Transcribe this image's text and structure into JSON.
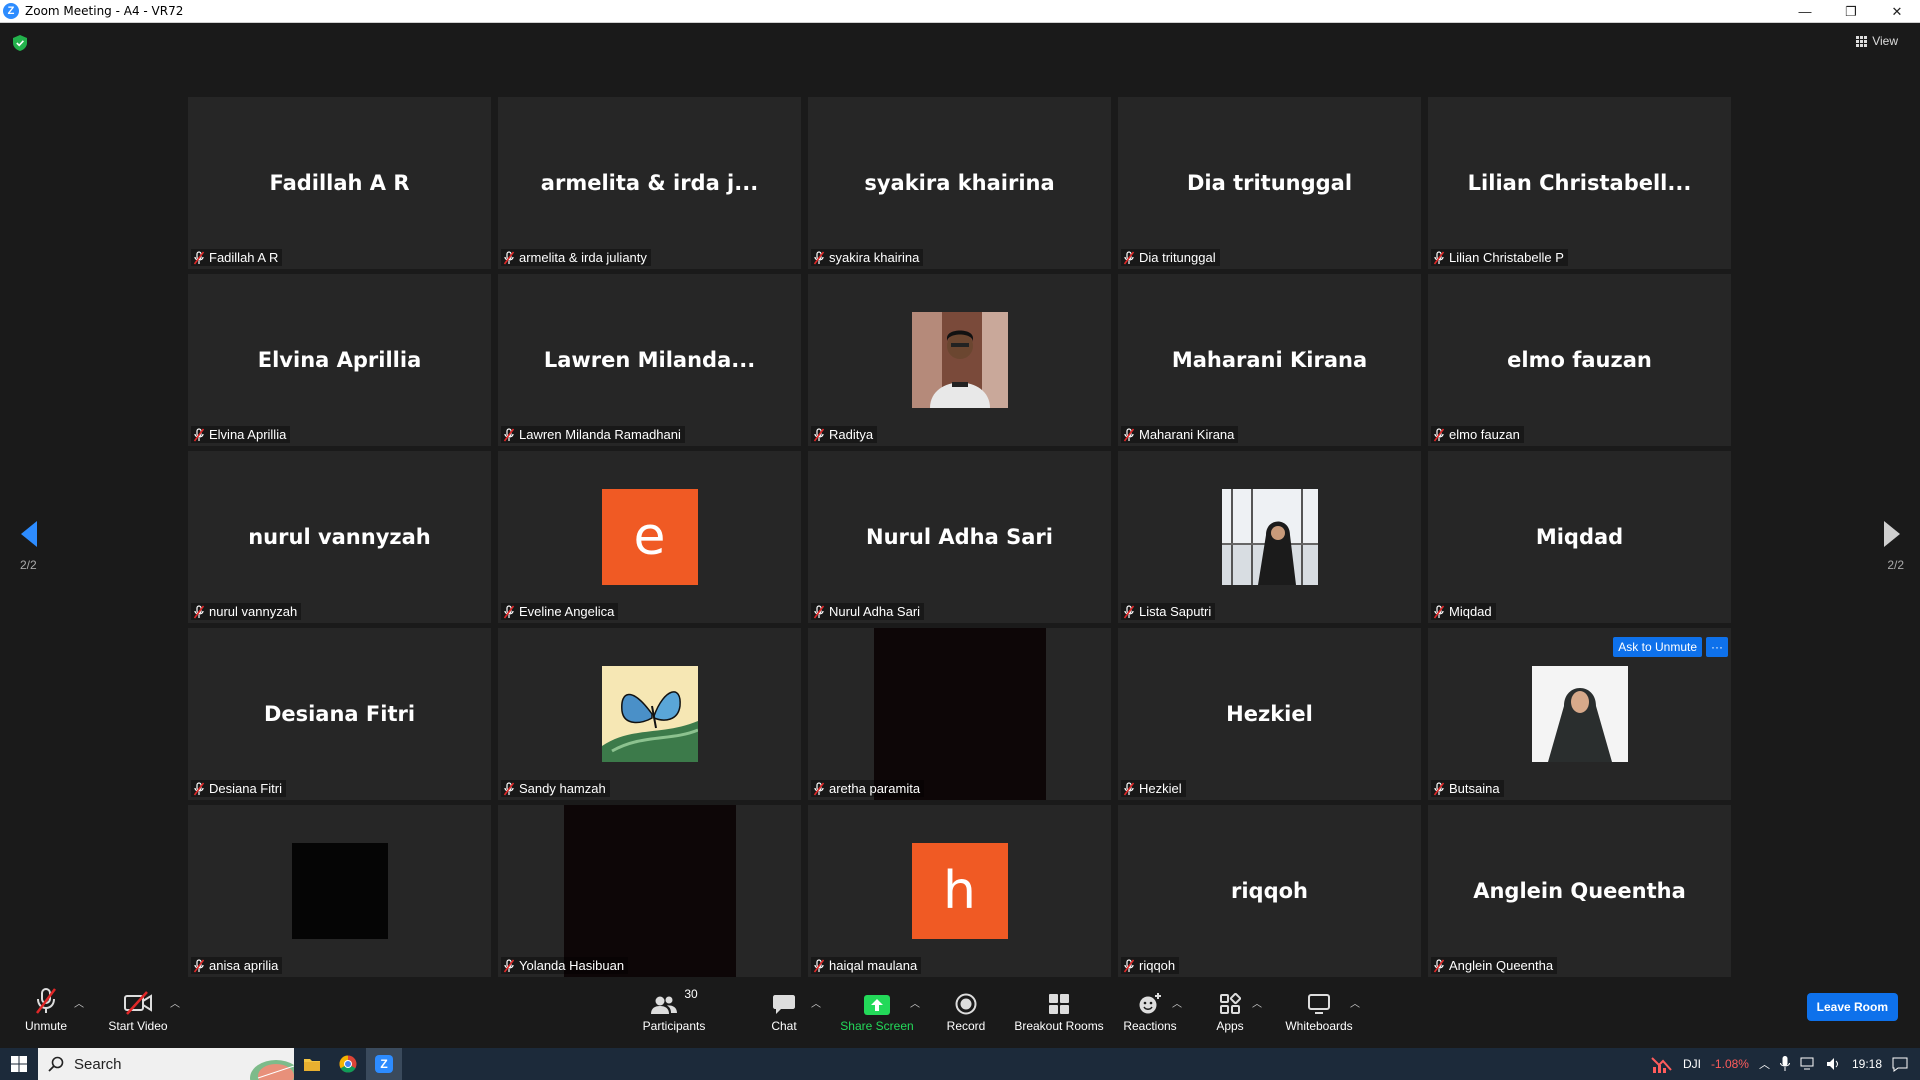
{
  "window": {
    "title": "Zoom Meeting - A4 - VR72",
    "minimize": "—",
    "restore": "❐",
    "close": "✕"
  },
  "header": {
    "view_label": "View"
  },
  "pagination": {
    "left": "2/2",
    "right": "2/2"
  },
  "tiles": [
    {
      "display": "Fadillah A R",
      "label": "Fadillah A R",
      "kind": "name"
    },
    {
      "display": "armelita & irda j...",
      "label": "armelita & irda julianty",
      "kind": "name"
    },
    {
      "display": "syakira khairina",
      "label": "syakira khairina",
      "kind": "name"
    },
    {
      "display": "Dia tritunggal",
      "label": "Dia tritunggal",
      "kind": "name"
    },
    {
      "display": "Lilian  Christabell...",
      "label": "Lilian Christabelle P",
      "kind": "name"
    },
    {
      "display": "Elvina Aprillia",
      "label": "Elvina Aprillia",
      "kind": "name"
    },
    {
      "display": "Lawren  Milanda...",
      "label": "Lawren Milanda Ramadhani",
      "kind": "name"
    },
    {
      "display": "",
      "label": "Raditya",
      "kind": "photo-boy"
    },
    {
      "display": "Maharani Kirana",
      "label": "Maharani Kirana",
      "kind": "name"
    },
    {
      "display": "elmo fauzan",
      "label": "elmo fauzan",
      "kind": "name"
    },
    {
      "display": "nurul vannyzah",
      "label": "nurul vannyzah",
      "kind": "name"
    },
    {
      "display": "e",
      "label": "Eveline Angelica",
      "kind": "letter"
    },
    {
      "display": "Nurul Adha Sari",
      "label": "Nurul Adha Sari",
      "kind": "name"
    },
    {
      "display": "",
      "label": "Lista Saputri",
      "kind": "photo-hijab-window"
    },
    {
      "display": "Miqdad",
      "label": "Miqdad",
      "kind": "name"
    },
    {
      "display": "Desiana Fitri",
      "label": "Desiana Fitri",
      "kind": "name"
    },
    {
      "display": "",
      "label": "Sandy hamzah",
      "kind": "butterfly"
    },
    {
      "display": "",
      "label": "aretha paramita",
      "kind": "black-video"
    },
    {
      "display": "Hezkiel",
      "label": "Hezkiel",
      "kind": "name"
    },
    {
      "display": "",
      "label": "Butsaina",
      "kind": "photo-hijab"
    },
    {
      "display": "",
      "label": "anisa aprilia",
      "kind": "black-square"
    },
    {
      "display": "",
      "label": "Yolanda Hasibuan",
      "kind": "black-video"
    },
    {
      "display": "h",
      "label": "haiqal maulana",
      "kind": "letter"
    },
    {
      "display": "riqqoh",
      "label": "riqqoh",
      "kind": "name"
    },
    {
      "display": "Anglein Queentha",
      "label": "Anglein Queentha",
      "kind": "name"
    }
  ],
  "hover_actions": {
    "ask_unmute": "Ask to Unmute",
    "more": "···"
  },
  "toolbar": {
    "unmute": "Unmute",
    "start_video": "Start Video",
    "participants": "Participants",
    "participants_count": "30",
    "chat": "Chat",
    "share_screen": "Share Screen",
    "record": "Record",
    "breakout_rooms": "Breakout Rooms",
    "reactions": "Reactions",
    "apps": "Apps",
    "whiteboards": "Whiteboards",
    "leave_room": "Leave Room"
  },
  "taskbar": {
    "search_label": "Search",
    "stock_name": "DJI",
    "stock_change": "-1.08%",
    "clock": "19:18"
  },
  "colors": {
    "accent": "#0e71eb",
    "share_green": "#23d959",
    "avatar_orange": "#f05a24",
    "muted_red": "#e02828"
  }
}
